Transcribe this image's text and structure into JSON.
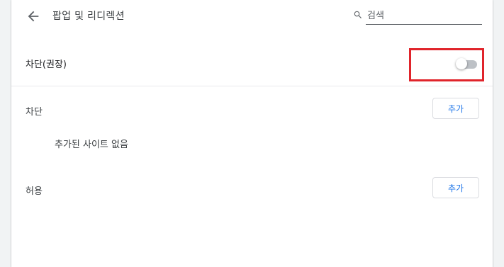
{
  "header": {
    "title": "팝업 및 리디렉션",
    "back_icon": "arrow-back-icon",
    "search": {
      "icon": "search-icon",
      "placeholder": "검색",
      "value": ""
    }
  },
  "main_setting": {
    "label": "차단(권장)",
    "toggle_state": false
  },
  "block_section": {
    "label": "차단",
    "add_label": "추가",
    "empty_text": "추가된 사이트 없음"
  },
  "allow_section": {
    "label": "허용",
    "add_label": "추가"
  },
  "colors": {
    "accent": "#1a73e8",
    "highlight": "#e0242b",
    "toggle_off_track": "#bdc1c6"
  }
}
